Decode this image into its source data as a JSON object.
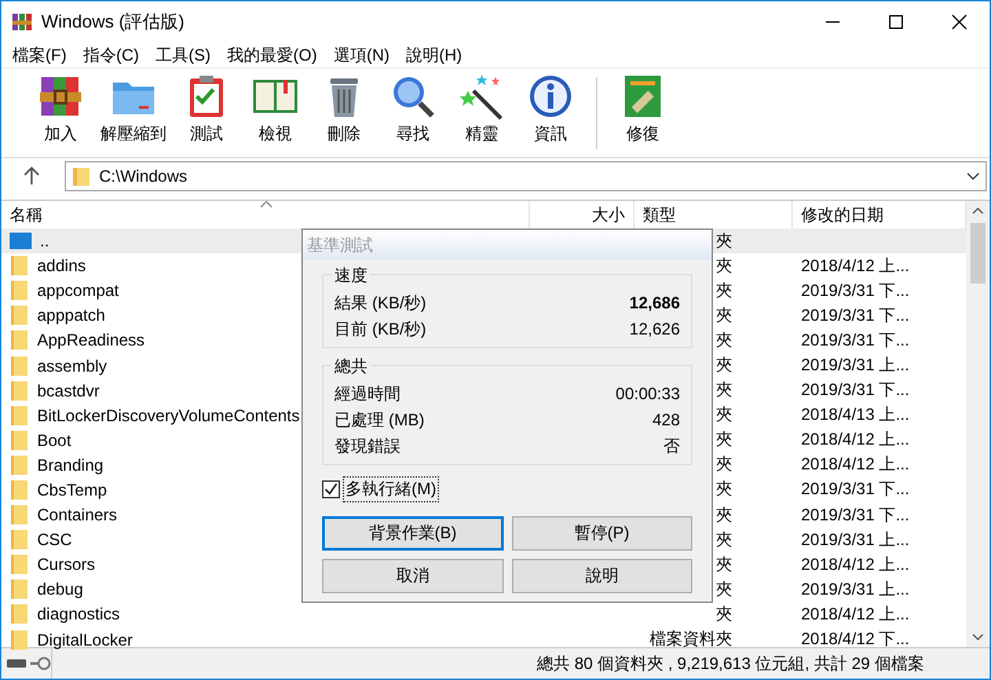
{
  "window": {
    "title": "Windows (評估版)"
  },
  "menu": [
    "檔案(F)",
    "指令(C)",
    "工具(S)",
    "我的最愛(O)",
    "選項(N)",
    "說明(H)"
  ],
  "toolbar_groups": [
    {
      "buttons": [
        {
          "label": "加入",
          "kind": "archive"
        },
        {
          "label": "解壓縮到",
          "kind": "folder"
        },
        {
          "label": "測試",
          "kind": "clipboard"
        },
        {
          "label": "檢視",
          "kind": "book"
        },
        {
          "label": "刪除",
          "kind": "trash"
        },
        {
          "label": "尋找",
          "kind": "magnifier"
        },
        {
          "label": "精靈",
          "kind": "wand"
        },
        {
          "label": "資訊",
          "kind": "info"
        }
      ]
    },
    {
      "buttons": [
        {
          "label": "修復",
          "kind": "repair"
        }
      ]
    }
  ],
  "address": {
    "path": "C:\\Windows"
  },
  "table": {
    "columns": [
      "名稱",
      "大小",
      "類型",
      "修改的日期"
    ],
    "rows": [
      {
        "name": "..",
        "kind": "parent",
        "type": "夾",
        "date": "",
        "selected": true
      },
      {
        "name": "addins",
        "kind": "folder",
        "type": "夾",
        "date": "2018/4/12 上...",
        "selected": false
      },
      {
        "name": "appcompat",
        "kind": "folder",
        "type": "夾",
        "date": "2019/3/31 下...",
        "selected": false
      },
      {
        "name": "apppatch",
        "kind": "folder",
        "type": "夾",
        "date": "2019/3/31 下...",
        "selected": false
      },
      {
        "name": "AppReadiness",
        "kind": "folder",
        "type": "夾",
        "date": "2019/3/31 下...",
        "selected": false
      },
      {
        "name": "assembly",
        "kind": "folder",
        "type": "夾",
        "date": "2019/3/31 上...",
        "selected": false
      },
      {
        "name": "bcastdvr",
        "kind": "folder",
        "type": "夾",
        "date": "2019/3/31 下...",
        "selected": false
      },
      {
        "name": "BitLockerDiscoveryVolumeContents",
        "kind": "folder",
        "type": "夾",
        "date": "2018/4/13 上...",
        "selected": false
      },
      {
        "name": "Boot",
        "kind": "folder",
        "type": "夾",
        "date": "2018/4/12 上...",
        "selected": false
      },
      {
        "name": "Branding",
        "kind": "folder",
        "type": "夾",
        "date": "2018/4/12 上...",
        "selected": false
      },
      {
        "name": "CbsTemp",
        "kind": "folder",
        "type": "夾",
        "date": "2019/3/31 下...",
        "selected": false
      },
      {
        "name": "Containers",
        "kind": "folder",
        "type": "夾",
        "date": "2019/3/31 下...",
        "selected": false
      },
      {
        "name": "CSC",
        "kind": "folder",
        "type": "夾",
        "date": "2019/3/31 上...",
        "selected": false
      },
      {
        "name": "Cursors",
        "kind": "folder",
        "type": "夾",
        "date": "2018/4/12 上...",
        "selected": false
      },
      {
        "name": "debug",
        "kind": "folder",
        "type": "夾",
        "date": "2019/3/31 上...",
        "selected": false
      },
      {
        "name": "diagnostics",
        "kind": "folder",
        "type": "夾",
        "date": "2018/4/12 上...",
        "selected": false
      },
      {
        "name": "DigitalLocker",
        "kind": "folder",
        "type": "檔案資料夾",
        "date": "2018/4/12 下...",
        "selected": false
      }
    ]
  },
  "dialog": {
    "title": "基準測試",
    "groups": [
      {
        "title": "速度",
        "rows": [
          {
            "label": "結果 (KB/秒)",
            "value": "12,686",
            "emphasis": true
          },
          {
            "label": "目前 (KB/秒)",
            "value": "12,626",
            "emphasis": false
          }
        ]
      },
      {
        "title": "總共",
        "rows": [
          {
            "label": "經過時間",
            "value": "00:00:33",
            "emphasis": false
          },
          {
            "label": "已處理 (MB)",
            "value": "428",
            "emphasis": false
          },
          {
            "label": "發現錯誤",
            "value": "否",
            "emphasis": false
          }
        ]
      }
    ],
    "checkbox": {
      "label": "多執行緒(M)",
      "checked": true
    },
    "buttons": [
      {
        "label": "背景作業(B)",
        "default": true
      },
      {
        "label": "暫停(P)",
        "default": false
      },
      {
        "label": "取消",
        "default": false
      },
      {
        "label": "說明",
        "default": false
      }
    ]
  },
  "status_bar": {
    "text": "總共 80 個資料夾 , 9,219,613 位元組, 共計 29 個檔案"
  }
}
